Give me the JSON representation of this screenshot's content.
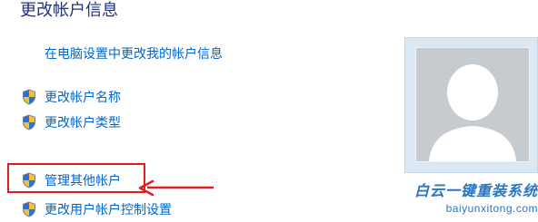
{
  "page": {
    "title": "更改帐户信息"
  },
  "links": {
    "pc_settings": "在电脑设置中更改我的帐户信息",
    "change_name": "更改帐户名称",
    "change_type": "更改帐户类型",
    "manage_other": "管理其他帐户",
    "uac_settings": "更改用户帐户控制设置"
  },
  "watermark": {
    "line1": "白云一键重装系统",
    "line2": "baiyunxitong.com"
  },
  "colors": {
    "link": "#0066cc",
    "title": "#1e3287",
    "highlight": "#e01c1c",
    "watermark": "#2a76c4"
  },
  "icons": {
    "shield": "uac-shield-icon",
    "avatar": "user-avatar-silhouette",
    "arrow": "red-arrow-annotation"
  }
}
